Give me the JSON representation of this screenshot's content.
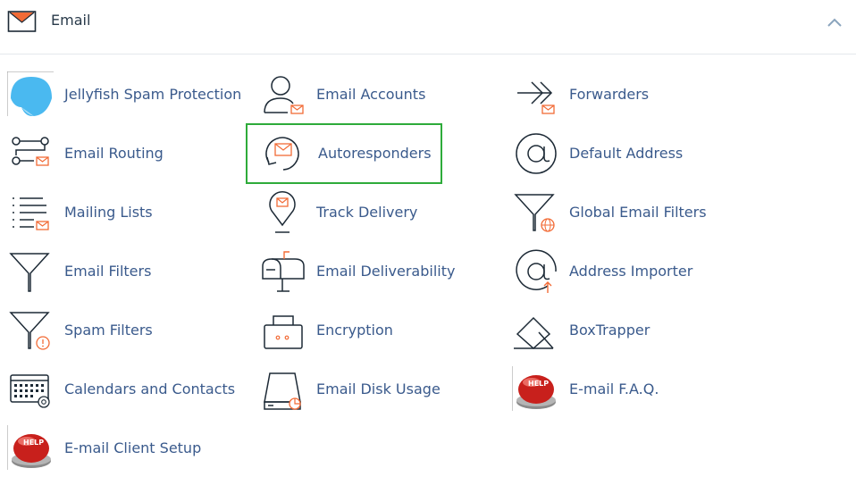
{
  "panel": {
    "title": "Email",
    "accent_color": "#f26b36",
    "highlight_color": "#2eab3a"
  },
  "items": [
    {
      "label": "Jellyfish Spam Protection",
      "icon": "jellyfish-icon"
    },
    {
      "label": "Email Accounts",
      "icon": "email-accounts-icon"
    },
    {
      "label": "Forwarders",
      "icon": "forwarders-icon"
    },
    {
      "label": "Email Routing",
      "icon": "email-routing-icon"
    },
    {
      "label": "Autoresponders",
      "icon": "autoresponders-icon",
      "highlighted": true
    },
    {
      "label": "Default Address",
      "icon": "default-address-icon"
    },
    {
      "label": "Mailing Lists",
      "icon": "mailing-lists-icon"
    },
    {
      "label": "Track Delivery",
      "icon": "track-delivery-icon"
    },
    {
      "label": "Global Email Filters",
      "icon": "global-email-filters-icon"
    },
    {
      "label": "Email Filters",
      "icon": "email-filters-icon"
    },
    {
      "label": "Email Deliverability",
      "icon": "email-deliverability-icon"
    },
    {
      "label": "Address Importer",
      "icon": "address-importer-icon"
    },
    {
      "label": "Spam Filters",
      "icon": "spam-filters-icon"
    },
    {
      "label": "Encryption",
      "icon": "encryption-icon"
    },
    {
      "label": "BoxTrapper",
      "icon": "boxtrapper-icon"
    },
    {
      "label": "Calendars and Contacts",
      "icon": "calendars-contacts-icon"
    },
    {
      "label": "Email Disk Usage",
      "icon": "email-disk-usage-icon"
    },
    {
      "label": "E-mail F.A.Q.",
      "icon": "help-button-icon"
    },
    {
      "label": "E-mail Client Setup",
      "icon": "help-button-icon"
    }
  ]
}
